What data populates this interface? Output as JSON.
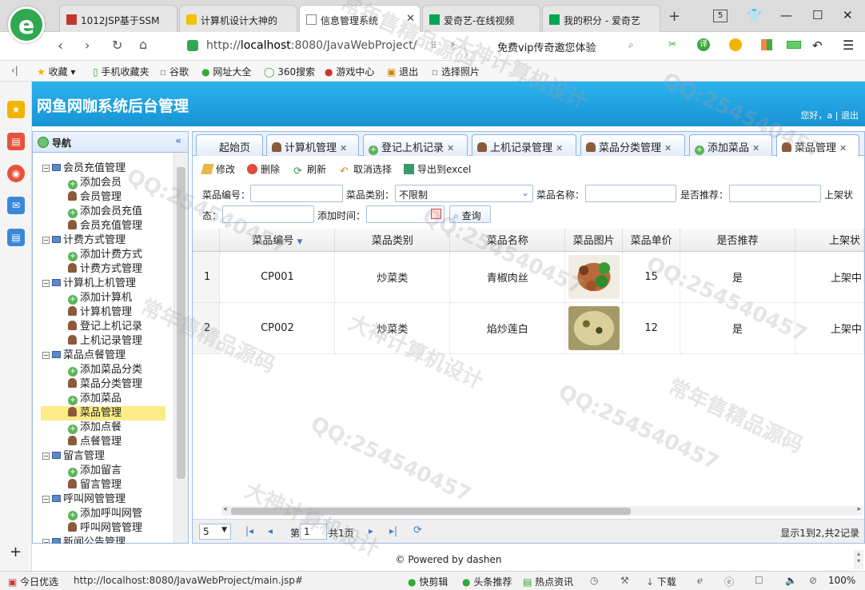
{
  "browser": {
    "tabs": [
      {
        "label": "1012JSP基于SSM",
        "color": "#c0392b"
      },
      {
        "label": "计算机设计大神的",
        "color": "#e6b800"
      },
      {
        "label": "信息管理系统",
        "color": "#888888"
      },
      {
        "label": "爱奇艺-在线视频",
        "color": "#00a651"
      },
      {
        "label": "我的积分 - 爱奇艺",
        "color": "#00a651"
      }
    ],
    "tab_count": "5",
    "url_prefix": "http://",
    "url_host": "localhost",
    "url_rest": ":8080/JavaWebProject/",
    "promo": "免费vip传奇邀您体验",
    "bookmarks": [
      "收藏",
      "手机收藏夹",
      "谷歌",
      "网址大全",
      "360搜索",
      "游戏中心",
      "退出",
      "选择照片"
    ]
  },
  "app": {
    "title": "网鱼网咖系统后台管理",
    "greeting": "您好，a | ",
    "logout": "退出"
  },
  "nav": {
    "title": "导航",
    "groups": [
      {
        "label": "会员充值管理",
        "items": [
          "添加会员",
          "会员管理",
          "添加会员充值",
          "会员充值管理"
        ]
      },
      {
        "label": "计费方式管理",
        "items": [
          "添加计费方式",
          "计费方式管理"
        ]
      },
      {
        "label": "计算机上机管理",
        "items": [
          "添加计算机",
          "计算机管理",
          "登记上机记录",
          "上机记录管理"
        ]
      },
      {
        "label": "菜品点餐管理",
        "items": [
          "添加菜品分类",
          "菜品分类管理",
          "添加菜品",
          "菜品管理",
          "添加点餐",
          "点餐管理"
        ]
      },
      {
        "label": "留言管理",
        "items": [
          "添加留言",
          "留言管理"
        ]
      },
      {
        "label": "呼叫网管管理",
        "items": [
          "添加呼叫网管",
          "呼叫网管管理"
        ]
      },
      {
        "label": "新闻公告管理",
        "items": []
      }
    ],
    "selected": "菜品管理"
  },
  "tabs": [
    {
      "label": "起始页",
      "closable": false
    },
    {
      "label": "计算机管理",
      "closable": true,
      "icon": "user"
    },
    {
      "label": "登记上机记录",
      "closable": true,
      "icon": "add"
    },
    {
      "label": "上机记录管理",
      "closable": true,
      "icon": "user"
    },
    {
      "label": "菜品分类管理",
      "closable": true,
      "icon": "user"
    },
    {
      "label": "添加菜品",
      "closable": true,
      "icon": "add"
    },
    {
      "label": "菜品管理",
      "closable": true,
      "icon": "user",
      "active": true
    }
  ],
  "toolbar": {
    "edit": "修改",
    "delete": "删除",
    "refresh": "刷新",
    "unselect": "取消选择",
    "export": "导出到excel"
  },
  "search": {
    "no_label": "菜品编号：",
    "type_label": "菜品类别：",
    "type_value": "不限制",
    "name_label": "菜品名称：",
    "recommend_label": "是否推荐：",
    "status_label_a": "上架状",
    "status_label_b": "态：",
    "time_label": "添加时间：",
    "query": "查询"
  },
  "grid": {
    "columns": [
      "菜品编号",
      "菜品类别",
      "菜品名称",
      "菜品图片",
      "菜品单价",
      "是否推荐",
      "上架状"
    ],
    "rows": [
      {
        "rn": "1",
        "no": "CP001",
        "type": "炒菜类",
        "name": "青椒肉丝",
        "image": "dish-green-pepper-pork",
        "price": "15",
        "recommend": "是",
        "status": "上架中"
      },
      {
        "rn": "2",
        "no": "CP002",
        "type": "炒菜类",
        "name": "焰炒莲白",
        "image": "dish-fried-cabbage",
        "price": "12",
        "recommend": "是",
        "status": "上架中"
      }
    ]
  },
  "pager": {
    "page_size": "5",
    "page_label": "第",
    "page_value": "1",
    "total_pages": "共1页",
    "info": "显示1到2,共2记录"
  },
  "footer": "© Powered by dashen",
  "statusbar": {
    "left": "今日优选",
    "url": "http://localhost:8080/JavaWebProject/main.jsp#",
    "items": [
      "快剪辑",
      "头条推荐",
      "热点资讯",
      "下载"
    ],
    "zoom": "100%"
  },
  "watermarks": [
    "QQ:254540457",
    "大神计算机设计",
    "常年售精品源码"
  ],
  "colors": {
    "header": "#1fa3e0",
    "nav_border": "#99bbe8",
    "selected": "#fbec88"
  }
}
